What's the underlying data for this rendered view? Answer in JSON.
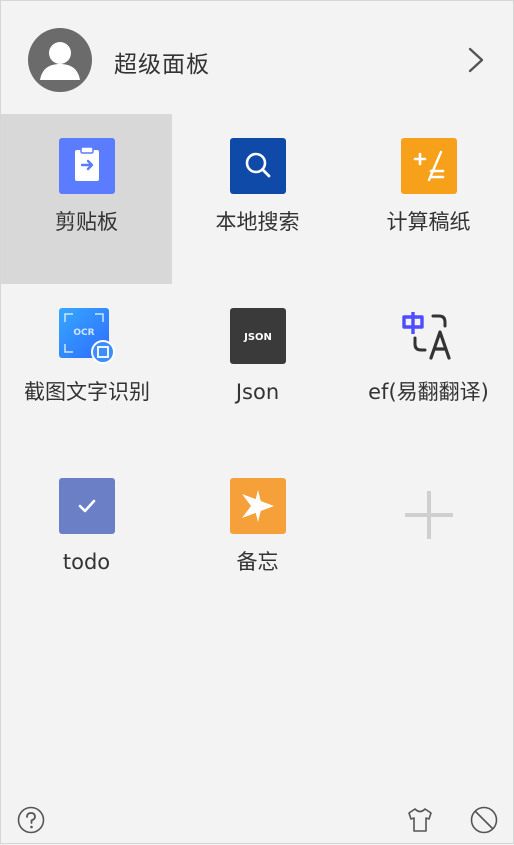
{
  "header": {
    "title": "超级面板"
  },
  "tiles": [
    {
      "label": "剪贴板",
      "icon": "clipboard-icon",
      "color": "#5b7cff",
      "selected": true
    },
    {
      "label": "本地搜索",
      "icon": "search-icon",
      "color": "#0f4aa8"
    },
    {
      "label": "计算稿纸",
      "icon": "calculator-icon",
      "color": "#f7a11a"
    },
    {
      "label": "截图文字识别",
      "icon": "ocr-icon",
      "color": "#3d8dff"
    },
    {
      "label": "Json",
      "icon": "json-icon",
      "color": "#3a3a3a",
      "icon_text": "JSON"
    },
    {
      "label": "ef(易翻翻译)",
      "icon": "translate-icon",
      "color": "#4e4cff"
    },
    {
      "label": "todo",
      "icon": "todo-check-icon",
      "color": "#6a7fc5"
    },
    {
      "label": "备忘",
      "icon": "memo-star-icon",
      "color": "#f5a038"
    }
  ],
  "footer": {
    "help_icon": "help-icon",
    "theme_icon": "shirt-icon",
    "block_icon": "block-icon"
  }
}
